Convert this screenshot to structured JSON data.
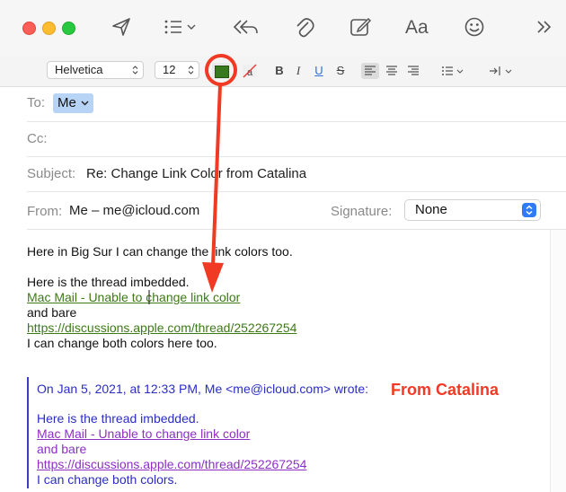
{
  "toolbar": {
    "icons": [
      "send-icon",
      "list-format-icon",
      "reply-all-icon",
      "attachment-icon",
      "compose-note-icon",
      "font-panel-icon",
      "emoji-icon",
      "more-chevrons-icon"
    ],
    "font_panel_label": "Aa"
  },
  "format_bar": {
    "font_family": "Helvetica",
    "font_size": "12",
    "text_color": "#3a7a1e",
    "bold_label": "B",
    "italic_label": "I",
    "underline_label": "U",
    "strike_label": "S"
  },
  "header": {
    "to_label": "To:",
    "to_recipient": "Me",
    "cc_label": "Cc:",
    "subject_label": "Subject:",
    "subject_value": "Re: Change Link Color from Catalina",
    "from_label": "From:",
    "from_value": "Me – me@icloud.com",
    "signature_label": "Signature:",
    "signature_value": "None"
  },
  "body": {
    "line1": "Here in Big Sur I can change the link colors too.",
    "line2": "Here is the thread imbedded.",
    "link1": "Mac Mail - Unable to change link color",
    "line3": "and bare",
    "link2": "https://discussions.apple.com/thread/252267254",
    "line4": "I can change both colors here too."
  },
  "quote": {
    "attribution": "On Jan 5, 2021, at 12:33 PM, Me <me@icloud.com> wrote:",
    "line1": "Here is the thread imbedded.",
    "link1": "Mac Mail - Unable to change link color",
    "line2": "and bare",
    "link2": "https://discussions.apple.com/thread/252267254",
    "line3": "I can change both colors."
  },
  "annotation": {
    "label": "From Catalina",
    "color": "#f03a24"
  }
}
